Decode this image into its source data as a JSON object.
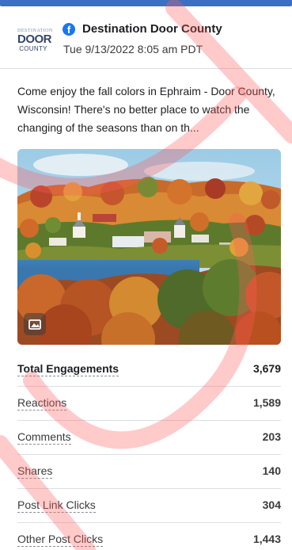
{
  "post": {
    "page_name": "Destination Door County",
    "timestamp": "Tue 9/13/2022 8:05 am PDT",
    "caption": "Come enjoy the fall colors in Ephraim - Door County, Wisconsin! There's no better place to watch the changing of the seasons than on th..."
  },
  "logo": {
    "line1": "DESTINATION",
    "line2": "DOOR",
    "line3": "COUNTY"
  },
  "icons": {
    "platform": "facebook-icon",
    "media": "image-icon"
  },
  "colors": {
    "accent_bar": "#3b6fc4",
    "facebook_blue": "#1877f2",
    "watermark": "#ff5a5a"
  },
  "metrics": [
    {
      "label": "Total Engagements",
      "value": "3,679"
    },
    {
      "label": "Reactions",
      "value": "1,589"
    },
    {
      "label": "Comments",
      "value": "203"
    },
    {
      "label": "Shares",
      "value": "140"
    },
    {
      "label": "Post Link Clicks",
      "value": "304"
    },
    {
      "label": "Other Post Clicks",
      "value": "1,443"
    }
  ]
}
